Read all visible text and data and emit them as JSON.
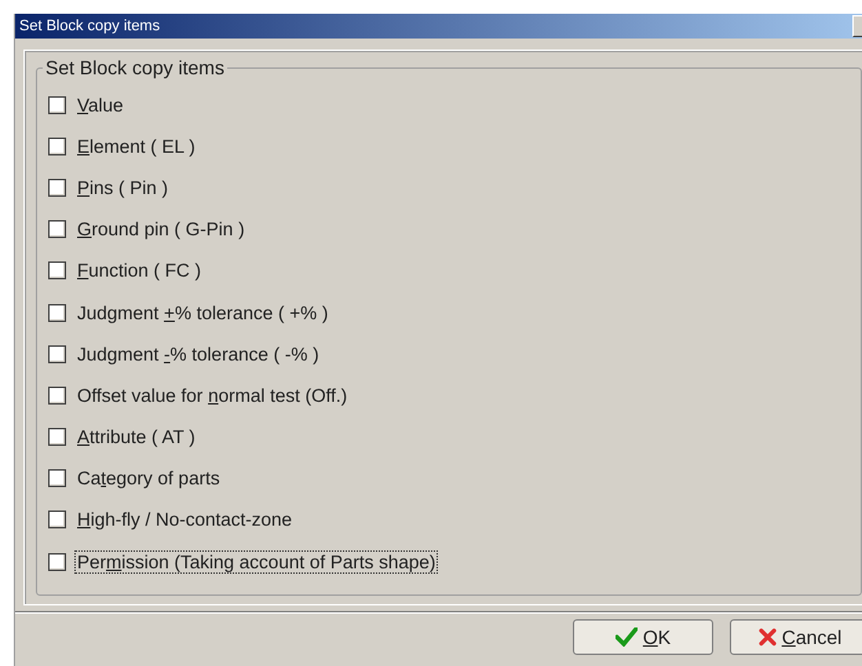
{
  "window": {
    "title": "Set Block copy items"
  },
  "group": {
    "title": "Set Block copy items"
  },
  "items": [
    {
      "key": "V",
      "post": "alue",
      "checked": false,
      "focused": false
    },
    {
      "key": "E",
      "post": "lement ( EL )",
      "checked": false,
      "focused": false
    },
    {
      "key": "P",
      "post": "ins ( Pin )",
      "checked": false,
      "focused": false
    },
    {
      "key": "G",
      "post": "round pin ( G-Pin )",
      "checked": false,
      "focused": false
    },
    {
      "key": "F",
      "post": "unction ( FC )",
      "checked": false,
      "focused": false
    },
    {
      "pre": "Judgment ",
      "key": "+",
      "post": "% tolerance ( +% )",
      "checked": false,
      "focused": false
    },
    {
      "pre": "Judgment ",
      "key": "-",
      "post": "% tolerance ( -% )",
      "checked": false,
      "focused": false
    },
    {
      "pre": "Offset value for ",
      "key": "n",
      "post": "ormal test (Off.)",
      "checked": false,
      "focused": false
    },
    {
      "key": "A",
      "post": "ttribute ( AT )",
      "checked": false,
      "focused": false
    },
    {
      "pre": "Ca",
      "key": "t",
      "post": "egory of parts",
      "checked": false,
      "focused": false
    },
    {
      "key": "H",
      "post": "igh-fly / No-contact-zone",
      "checked": false,
      "focused": false
    },
    {
      "pre": "Per",
      "key": "m",
      "post": "ission (Taking account of Parts shape)",
      "checked": false,
      "focused": true
    }
  ],
  "buttons": [
    {
      "kind": "ok",
      "key": "O",
      "post": "K"
    },
    {
      "kind": "cancel",
      "key": "C",
      "post": "ancel"
    }
  ]
}
